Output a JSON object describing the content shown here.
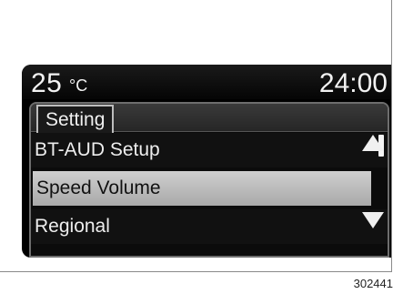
{
  "status_bar": {
    "temperature_value": "25",
    "temperature_unit": "°C",
    "clock": "24:00"
  },
  "menu": {
    "title": "Setting",
    "items": [
      {
        "label": "BT-AUD Setup",
        "selected": false
      },
      {
        "label": "Speed Volume",
        "selected": true
      },
      {
        "label": "Regional",
        "selected": false
      }
    ],
    "scroll_up_icon": "triangle-up-icon",
    "scroll_down_icon": "triangle-down-icon"
  },
  "figure_code": "302441",
  "colors": {
    "screen_bg": "#000000",
    "selected_bg": "#bdbdbd",
    "text": "#ededed"
  }
}
